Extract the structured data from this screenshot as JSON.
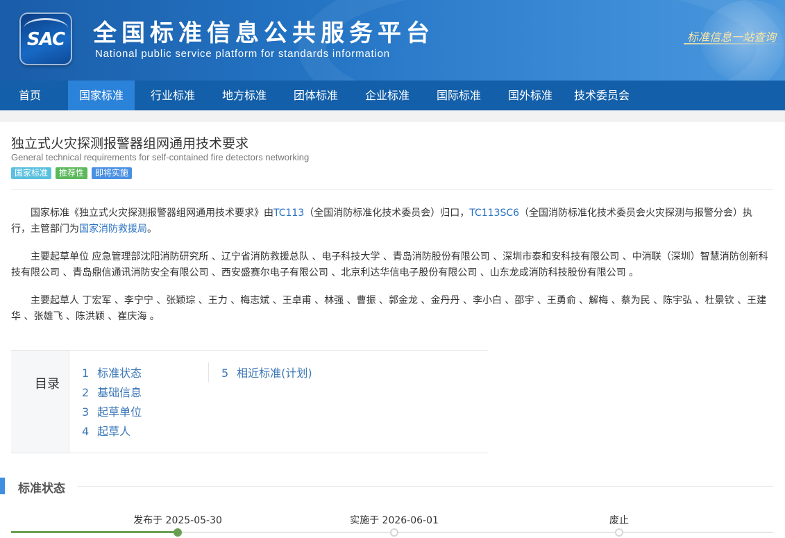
{
  "header": {
    "logo_text": "SAC",
    "site_title": "全国标准信息公共服务平台",
    "site_subtitle": "National public service platform  for standards information",
    "slogan": "标准信息一站查询"
  },
  "nav": {
    "items": [
      {
        "label": "首页",
        "active": false
      },
      {
        "label": "国家标准",
        "active": true
      },
      {
        "label": "行业标准",
        "active": false
      },
      {
        "label": "地方标准",
        "active": false
      },
      {
        "label": "团体标准",
        "active": false
      },
      {
        "label": "企业标准",
        "active": false
      },
      {
        "label": "国际标准",
        "active": false
      },
      {
        "label": "国外标准",
        "active": false
      },
      {
        "label": "技术委员会",
        "active": false
      }
    ]
  },
  "standard": {
    "title": "独立式火灾探测报警器组网通用技术要求",
    "title_en": "General technical requirements for self-contained fire detectors networking",
    "badges": [
      {
        "label": "国家标准",
        "color": "#5bc0de"
      },
      {
        "label": "推荐性",
        "color": "#5cb85c"
      },
      {
        "label": "即将实施",
        "color": "#4a90e2"
      }
    ]
  },
  "description": {
    "p1_prefix": "国家标准《独立式火灾探测报警器组网通用技术要求》由",
    "p1_tc": "TC113",
    "p1_tc_desc": "（全国消防标准化技术委员会）归口，",
    "p1_sc": "TC113SC6",
    "p1_sc_desc": "（全国消防标准化技术委员会火灾探测与报警分会）执行，主管部门为",
    "p1_dept": "国家消防救援局",
    "p1_end": "。",
    "p2": "主要起草单位 应急管理部沈阳消防研究所 、辽宁省消防救援总队 、电子科技大学 、青岛消防股份有限公司 、深圳市泰和安科技有限公司 、中消联（深圳）智慧消防创新科技有限公司 、青岛鼎信通讯消防安全有限公司 、西安盛赛尔电子有限公司 、北京利达华信电子股份有限公司 、山东龙成消防科技股份有限公司 。",
    "p3": "主要起草人 丁宏军 、李宁宁 、张颖琮 、王力 、梅志斌 、王卓甫 、林强 、曹振 、郭金龙 、金丹丹 、李小白 、邵宇 、王勇俞 、解梅 、蔡为民 、陈宇弘 、杜景钦 、王建华 、张雄飞 、陈洪颖 、崔庆海 。"
  },
  "toc": {
    "label": "目录",
    "items": [
      {
        "num": "1",
        "label": "标准状态"
      },
      {
        "num": "2",
        "label": "基础信息"
      },
      {
        "num": "3",
        "label": "起草单位"
      },
      {
        "num": "4",
        "label": "起草人"
      },
      {
        "num": "5",
        "label": "相近标准(计划)"
      }
    ]
  },
  "status_section": {
    "title": "标准状态",
    "timeline": [
      {
        "label": "发布于 2025-05-30",
        "done": true
      },
      {
        "label": "实施于 2026-06-01",
        "done": false
      },
      {
        "label": "废止",
        "done": false
      }
    ]
  }
}
